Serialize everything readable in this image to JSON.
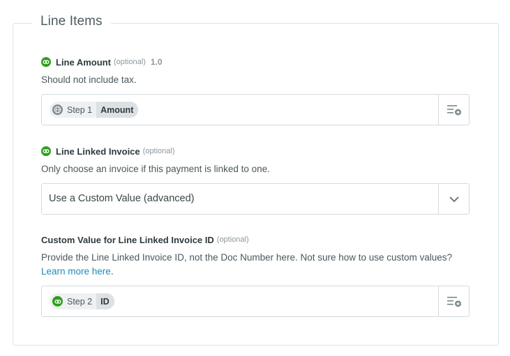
{
  "section": {
    "title": "Line Items"
  },
  "fields": [
    {
      "label": "Line Amount",
      "optional": "(optional)",
      "version": "1.0",
      "help": "Should not include tax.",
      "pill": {
        "step": "Step 1",
        "value": "Amount",
        "icon": "globe-icon"
      }
    },
    {
      "label": "Line Linked Invoice",
      "optional": "(optional)",
      "help": "Only choose an invoice if this payment is linked to one.",
      "select_value": "Use a Custom Value (advanced)"
    },
    {
      "label": "Custom Value for Line Linked Invoice ID",
      "optional": "(optional)",
      "help_line1": "Provide the Line Linked Invoice ID, not the Doc Number here. Not sure how to use custom values?",
      "help_link": "Learn more here",
      "help_link_suffix": ".",
      "pill": {
        "step": "Step 2",
        "value": "ID",
        "icon": "quickbooks-icon"
      }
    }
  ],
  "colors": {
    "quickbooks_green": "#2ca01c",
    "link": "#1c8bb8"
  }
}
